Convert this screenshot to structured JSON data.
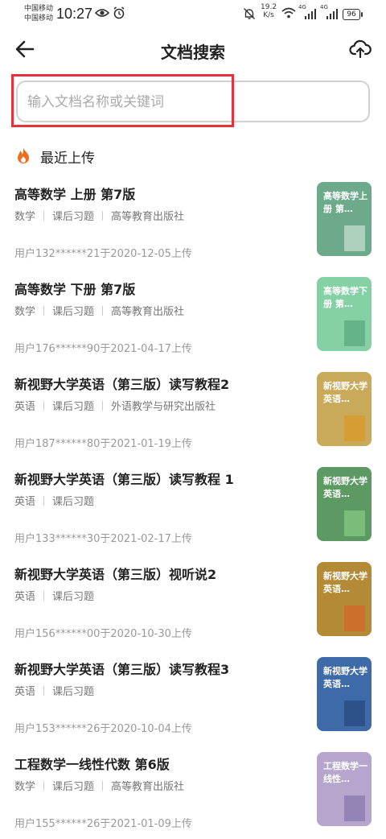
{
  "status_bar": {
    "carrier_1": "中国移动",
    "carrier_2": "中国移动",
    "time": "10:27",
    "net_speed_value": "19.2",
    "net_speed_unit": "K/s",
    "signal_1_label": "4G",
    "signal_2_label": "4G",
    "battery": "96"
  },
  "header": {
    "title": "文档搜索"
  },
  "search": {
    "placeholder": "输入文档名称或关键词",
    "value": ""
  },
  "section": {
    "title": "最近上传"
  },
  "documents": [
    {
      "title": "高等数学 上册 第7版",
      "subject": "数学",
      "category": "课后习题",
      "publisher": "高等教育出版社",
      "uploader": "用户132******21于2020-12-05上传",
      "thumb_label": "高等数学上册 第…",
      "thumb_color": "#6daa8c",
      "thumb_accent": "#b8d8c6"
    },
    {
      "title": "高等数学 下册 第7版",
      "subject": "数学",
      "category": "课后习题",
      "publisher": "高等教育出版社",
      "uploader": "用户176******90于2021-04-17上传",
      "thumb_label": "高等数学下册 第…",
      "thumb_color": "#86d0a6",
      "thumb_accent": "#5fae84"
    },
    {
      "title": "新视野大学英语（第三版）读写教程2",
      "subject": "英语",
      "category": "课后习题",
      "publisher": "外语教学与研究出版社",
      "uploader": "用户187******80于2021-01-19上传",
      "thumb_label": "新视野大学英语…",
      "thumb_color": "#c9a95a",
      "thumb_accent": "#d79b2e"
    },
    {
      "title": "新视野大学英语（第三版）读写教程 1",
      "subject": "英语",
      "category": "课后习题",
      "publisher": "",
      "uploader": "用户133******30于2021-02-17上传",
      "thumb_label": "新视野大学英语…",
      "thumb_color": "#5d9a63",
      "thumb_accent": "#7fc37e"
    },
    {
      "title": "新视野大学英语（第三版）视听说2",
      "subject": "英语",
      "category": "课后习题",
      "publisher": "",
      "uploader": "用户156******00于2020-10-30上传",
      "thumb_label": "新视野大学英语…",
      "thumb_color": "#b38a36",
      "thumb_accent": "#d06a2a"
    },
    {
      "title": "新视野大学英语（第三版）读写教程3",
      "subject": "英语",
      "category": "课后习题",
      "publisher": "",
      "uploader": "用户153******26于2020-10-04上传",
      "thumb_label": "新视野大学英语…",
      "thumb_color": "#3f6aa8",
      "thumb_accent": "#2a4e86"
    },
    {
      "title": "工程数学一线性代数 第6版",
      "subject": "数学",
      "category": "课后习题",
      "publisher": "高等教育出版社",
      "uploader": "用户155******26于2021-01-09上传",
      "thumb_label": "工程数学一线性…",
      "thumb_color": "#b6a5cc",
      "thumb_accent": "#8e7db0"
    }
  ]
}
